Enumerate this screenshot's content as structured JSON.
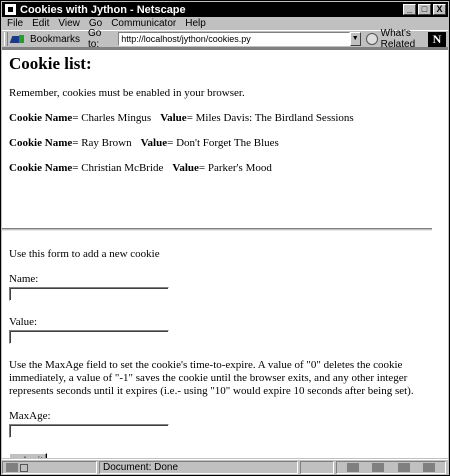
{
  "window": {
    "title": "Cookies with Jython - Netscape",
    "buttons": [
      "_",
      "□",
      "X"
    ]
  },
  "menubar": [
    "File",
    "Edit",
    "View",
    "Go",
    "Communicator",
    "Help"
  ],
  "toolbar": {
    "bookmarks_label": "Bookmarks",
    "goto_label": "Go to:",
    "url": "http://localhost/jython/cookies.py",
    "related_label": "What's Related",
    "logo": "N"
  },
  "page": {
    "heading": "Cookie list:",
    "reminder": "Remember, cookies must be enabled in your browser.",
    "cookies": [
      {
        "name_label": "Cookie Name",
        "name": "= Charles Mingus",
        "value_label": "Value",
        "value": "= Miles Davis: The Birdland Sessions"
      },
      {
        "name_label": "Cookie Name",
        "name": "= Ray Brown",
        "value_label": "Value",
        "value": "= Don't Forget The Blues"
      },
      {
        "name_label": "Cookie Name",
        "name": "= Christian McBride",
        "value_label": "Value",
        "value": "= Parker's Mood"
      }
    ],
    "form_intro": "Use this form to add a new cookie",
    "name_label": "Name:",
    "name_value": "",
    "value_label": "Value:",
    "value_value": "",
    "maxage_help": "Use the MaxAge field to set the cookie's time-to-expire. A value of \"0\" deletes the cookie immediately, a value of \"-1\" saves the cookie until the browser exits, and any other integer represents seconds until it expires (i.e.- using \"10\" would expire 10 seconds after being set).",
    "maxage_label": "MaxAge:",
    "maxage_value": "",
    "submit_label": "submit"
  },
  "statusbar": {
    "status": "Document: Done"
  }
}
